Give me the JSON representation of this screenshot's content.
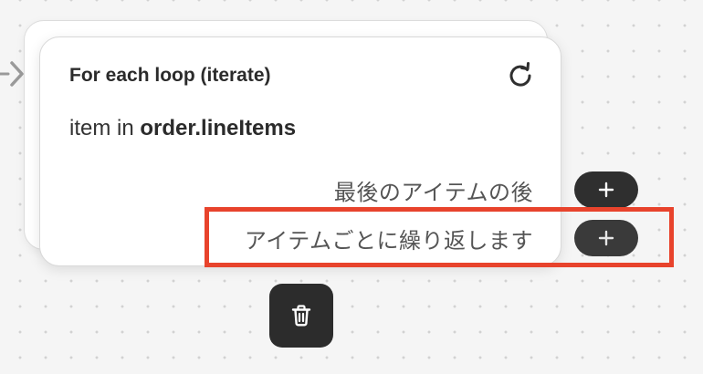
{
  "node": {
    "title": "For each loop (iterate)",
    "expression_prefix": "item in ",
    "expression_var": "order.lineItems"
  },
  "branches": {
    "after_last_item": "最後のアイテムの後",
    "for_each_item": "アイテムごとに繰り返します"
  },
  "icons": {
    "refresh": "refresh-icon",
    "add": "plus-icon",
    "delete": "trash-icon",
    "connector": "chevron-right-icon"
  },
  "colors": {
    "highlight": "#e8432c",
    "button_dark": "#2f2f2f",
    "canvas": "#f5f5f5"
  }
}
